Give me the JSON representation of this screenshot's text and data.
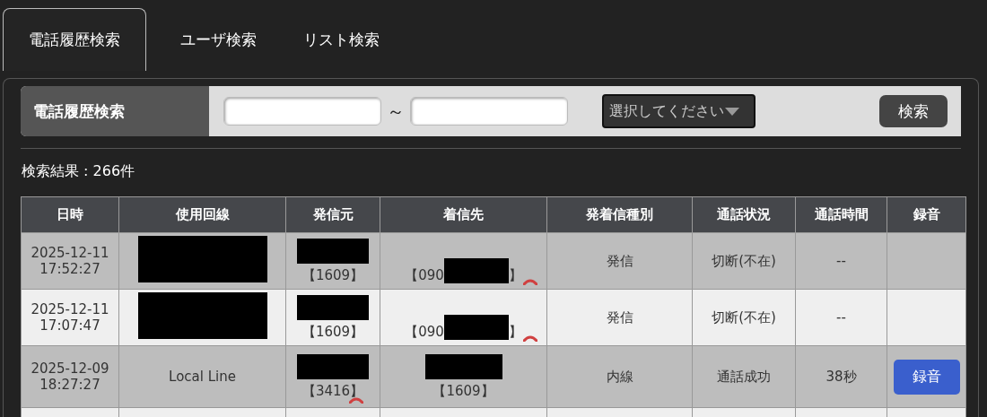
{
  "tabs": [
    {
      "label": "電話履歴検索",
      "selected": true
    },
    {
      "label": "ユーザ検索",
      "selected": false
    },
    {
      "label": "リスト検索",
      "selected": false
    }
  ],
  "search": {
    "label": "電話履歴検索",
    "range_separator": "～",
    "select_placeholder": "選択してください",
    "button": "検索"
  },
  "result_count": "検索結果 : 266件",
  "table": {
    "columns": [
      "日時",
      "使用回線",
      "発信元",
      "着信先",
      "発着信種別",
      "通話状況",
      "通話時間",
      "録音"
    ],
    "rows": [
      {
        "date": "2025-12-11",
        "time": "17:52:27",
        "line": {
          "kind": "redacted"
        },
        "caller": {
          "kind": "stacked",
          "text": "【1609】",
          "hangup": false
        },
        "callee": {
          "kind": "inline",
          "before": "【090",
          "after": "】",
          "hangup": true
        },
        "direction": "発信",
        "status": "切断(不在)",
        "duration": "--"
      },
      {
        "date": "2025-12-11",
        "time": "17:07:47",
        "line": {
          "kind": "redacted"
        },
        "caller": {
          "kind": "stacked",
          "text": "【1609】",
          "hangup": false
        },
        "callee": {
          "kind": "inline",
          "before": "【090",
          "after": "】",
          "hangup": true
        },
        "direction": "発信",
        "status": "切断(不在)",
        "duration": "--"
      },
      {
        "date": "2025-12-09",
        "time": "18:27:27",
        "line": {
          "kind": "text",
          "text": "Local Line"
        },
        "caller": {
          "kind": "stacked",
          "text": "【3416】",
          "hangup": true
        },
        "callee": {
          "kind": "stacked",
          "text": "【1609】",
          "hangup": false
        },
        "direction": "内線",
        "status": "通話成功",
        "duration": "38秒",
        "recording": "録音"
      }
    ]
  }
}
